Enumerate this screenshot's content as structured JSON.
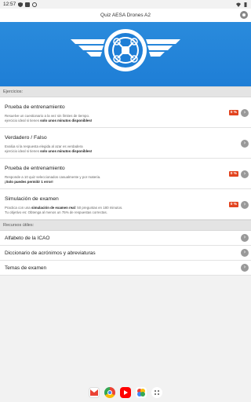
{
  "status": {
    "time": "12:57"
  },
  "app": {
    "title": "Quiz AESA Drones A2"
  },
  "sections": {
    "exercises": "Ejercicios:",
    "resources": "Recursos útiles:"
  },
  "cards": [
    {
      "title": "Prueba de entrenamiento",
      "desc_line1": "Resuelve un cuestionario a la vez sin límites de tiempo.",
      "desc_line2_plain": "ejercicio ideal si tienes ",
      "desc_line2_bold": "solo unos minutos disponibles!",
      "badge": "0 %"
    },
    {
      "title": "Verdadero / Falso",
      "desc_line1": "Evalúa si la respuesta elegida al azar es verdadera",
      "desc_line2_plain": "ejercicio ideal si tienes ",
      "desc_line2_bold": "solo unos minutos disponibles!"
    },
    {
      "title": "Prueba de entrenamiento",
      "desc_line1": "Responde a 10 quiz seleccionados casualmente y por materia.",
      "desc_line2_bold": "¡Solo puedes permitir 1 error!",
      "badge": "0 %"
    },
    {
      "title": "Simulación de examen",
      "desc_line1_plain": "Practica con una ",
      "desc_line1_bold": "simulación de examen real",
      "desc_line1_tail": ": 50 preguntas en 180 minutos.",
      "desc_line2_plain": "Tu objetivo es: Obtenga al menos un 75% de respuestas correctas.",
      "badge": "0 %"
    }
  ],
  "resources": [
    "Alfabeto de la ICAO",
    "Diccionario de acrónimos y abreviaturas",
    "Temas de examen"
  ],
  "colors": {
    "banner": "#1e7ed6",
    "badge": "#e2441f"
  }
}
